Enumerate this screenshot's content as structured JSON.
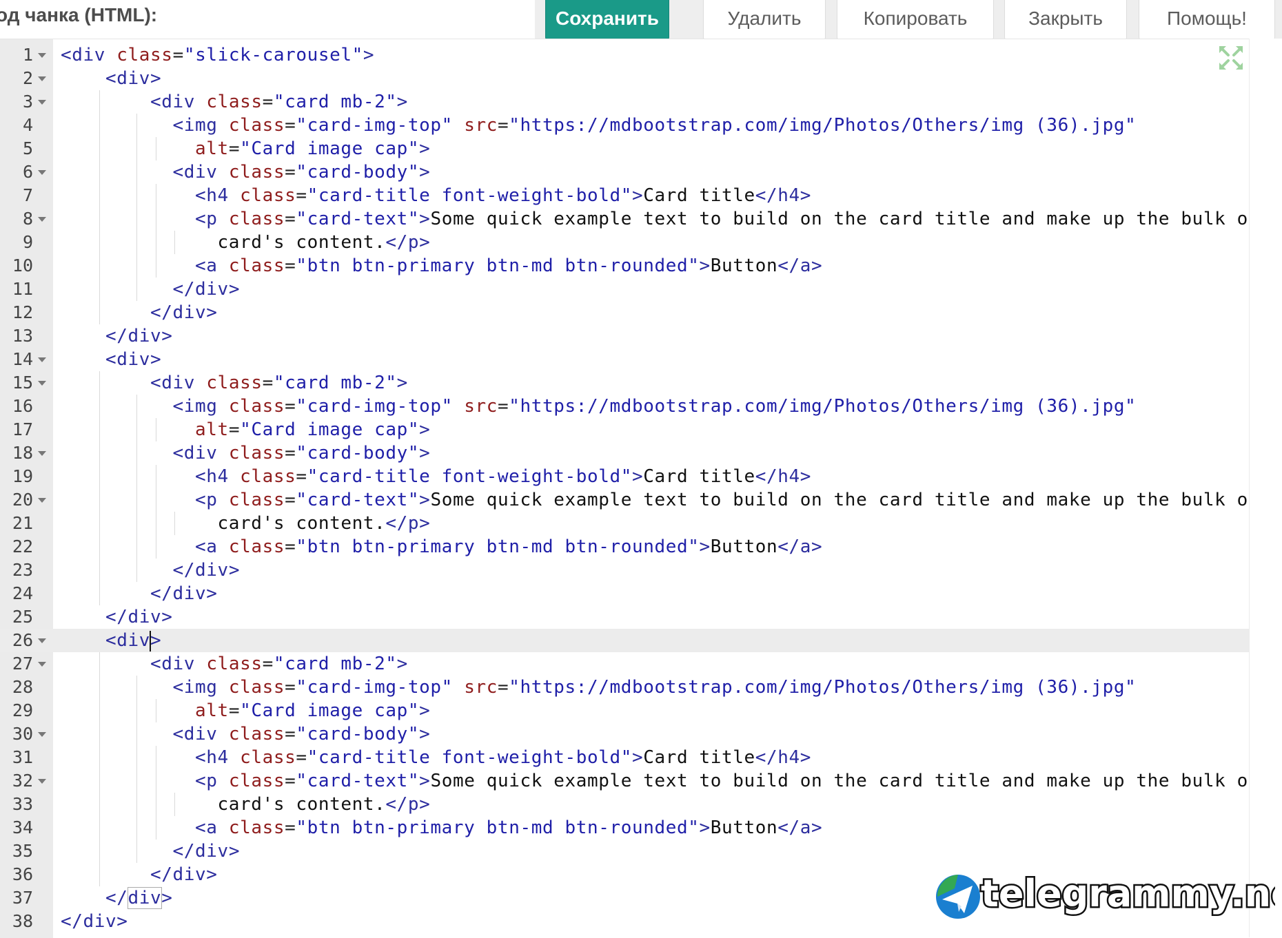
{
  "header": {
    "label": "од чанка (HTML):"
  },
  "toolbar": {
    "buttons": [
      {
        "label": "Сохранить",
        "primary": true
      },
      {
        "label": "Удалить"
      },
      {
        "label": "Копировать"
      },
      {
        "label": "Закрыть"
      },
      {
        "label": "Помощь!"
      }
    ]
  },
  "editor": {
    "active_line": 26,
    "fold_lines": [
      1,
      2,
      3,
      6,
      8,
      14,
      15,
      18,
      20,
      26,
      27,
      30,
      32
    ],
    "lines": [
      [
        [
          "tag",
          "<div"
        ],
        [
          "pun",
          " "
        ],
        [
          "attr",
          "class"
        ],
        [
          "pun",
          "="
        ],
        [
          "str",
          "\"slick-carousel\""
        ],
        [
          "tag",
          ">"
        ]
      ],
      [
        [
          "pun",
          "    "
        ],
        [
          "tag",
          "<div>"
        ]
      ],
      [
        [
          "pun",
          "        "
        ],
        [
          "tag",
          "<div"
        ],
        [
          "pun",
          " "
        ],
        [
          "attr",
          "class"
        ],
        [
          "pun",
          "="
        ],
        [
          "str",
          "\"card mb-2\""
        ],
        [
          "tag",
          ">"
        ]
      ],
      [
        [
          "pun",
          "          "
        ],
        [
          "tag",
          "<img"
        ],
        [
          "pun",
          " "
        ],
        [
          "attr",
          "class"
        ],
        [
          "pun",
          "="
        ],
        [
          "str",
          "\"card-img-top\""
        ],
        [
          "pun",
          " "
        ],
        [
          "attr",
          "src"
        ],
        [
          "pun",
          "="
        ],
        [
          "str",
          "\"https://mdbootstrap.com/img/Photos/Others/img (36).jpg\""
        ]
      ],
      [
        [
          "pun",
          "            "
        ],
        [
          "attr",
          "alt"
        ],
        [
          "pun",
          "="
        ],
        [
          "str",
          "\"Card image cap\""
        ],
        [
          "tag",
          ">"
        ]
      ],
      [
        [
          "pun",
          "          "
        ],
        [
          "tag",
          "<div"
        ],
        [
          "pun",
          " "
        ],
        [
          "attr",
          "class"
        ],
        [
          "pun",
          "="
        ],
        [
          "str",
          "\"card-body\""
        ],
        [
          "tag",
          ">"
        ]
      ],
      [
        [
          "pun",
          "            "
        ],
        [
          "tag",
          "<h4"
        ],
        [
          "pun",
          " "
        ],
        [
          "attr",
          "class"
        ],
        [
          "pun",
          "="
        ],
        [
          "str",
          "\"card-title font-weight-bold\""
        ],
        [
          "tag",
          ">"
        ],
        [
          "txt",
          "Card title"
        ],
        [
          "tag",
          "</h4>"
        ]
      ],
      [
        [
          "pun",
          "            "
        ],
        [
          "tag",
          "<p"
        ],
        [
          "pun",
          " "
        ],
        [
          "attr",
          "class"
        ],
        [
          "pun",
          "="
        ],
        [
          "str",
          "\"card-text\""
        ],
        [
          "tag",
          ">"
        ],
        [
          "txt",
          "Some quick example text to build on the card title and make up the bulk of"
        ]
      ],
      [
        [
          "pun",
          "              "
        ],
        [
          "txt",
          "card's content."
        ],
        [
          "tag",
          "</p>"
        ]
      ],
      [
        [
          "pun",
          "            "
        ],
        [
          "tag",
          "<a"
        ],
        [
          "pun",
          " "
        ],
        [
          "attr",
          "class"
        ],
        [
          "pun",
          "="
        ],
        [
          "str",
          "\"btn btn-primary btn-md btn-rounded\""
        ],
        [
          "tag",
          ">"
        ],
        [
          "txt",
          "Button"
        ],
        [
          "tag",
          "</a>"
        ]
      ],
      [
        [
          "pun",
          "          "
        ],
        [
          "tag",
          "</div>"
        ]
      ],
      [
        [
          "pun",
          "        "
        ],
        [
          "tag",
          "</div>"
        ]
      ],
      [
        [
          "pun",
          "    "
        ],
        [
          "tag",
          "</div>"
        ]
      ],
      [
        [
          "pun",
          "    "
        ],
        [
          "tag",
          "<div>"
        ]
      ],
      [
        [
          "pun",
          "        "
        ],
        [
          "tag",
          "<div"
        ],
        [
          "pun",
          " "
        ],
        [
          "attr",
          "class"
        ],
        [
          "pun",
          "="
        ],
        [
          "str",
          "\"card mb-2\""
        ],
        [
          "tag",
          ">"
        ]
      ],
      [
        [
          "pun",
          "          "
        ],
        [
          "tag",
          "<img"
        ],
        [
          "pun",
          " "
        ],
        [
          "attr",
          "class"
        ],
        [
          "pun",
          "="
        ],
        [
          "str",
          "\"card-img-top\""
        ],
        [
          "pun",
          " "
        ],
        [
          "attr",
          "src"
        ],
        [
          "pun",
          "="
        ],
        [
          "str",
          "\"https://mdbootstrap.com/img/Photos/Others/img (36).jpg\""
        ]
      ],
      [
        [
          "pun",
          "            "
        ],
        [
          "attr",
          "alt"
        ],
        [
          "pun",
          "="
        ],
        [
          "str",
          "\"Card image cap\""
        ],
        [
          "tag",
          ">"
        ]
      ],
      [
        [
          "pun",
          "          "
        ],
        [
          "tag",
          "<div"
        ],
        [
          "pun",
          " "
        ],
        [
          "attr",
          "class"
        ],
        [
          "pun",
          "="
        ],
        [
          "str",
          "\"card-body\""
        ],
        [
          "tag",
          ">"
        ]
      ],
      [
        [
          "pun",
          "            "
        ],
        [
          "tag",
          "<h4"
        ],
        [
          "pun",
          " "
        ],
        [
          "attr",
          "class"
        ],
        [
          "pun",
          "="
        ],
        [
          "str",
          "\"card-title font-weight-bold\""
        ],
        [
          "tag",
          ">"
        ],
        [
          "txt",
          "Card title"
        ],
        [
          "tag",
          "</h4>"
        ]
      ],
      [
        [
          "pun",
          "            "
        ],
        [
          "tag",
          "<p"
        ],
        [
          "pun",
          " "
        ],
        [
          "attr",
          "class"
        ],
        [
          "pun",
          "="
        ],
        [
          "str",
          "\"card-text\""
        ],
        [
          "tag",
          ">"
        ],
        [
          "txt",
          "Some quick example text to build on the card title and make up the bulk of"
        ]
      ],
      [
        [
          "pun",
          "              "
        ],
        [
          "txt",
          "card's content."
        ],
        [
          "tag",
          "</p>"
        ]
      ],
      [
        [
          "pun",
          "            "
        ],
        [
          "tag",
          "<a"
        ],
        [
          "pun",
          " "
        ],
        [
          "attr",
          "class"
        ],
        [
          "pun",
          "="
        ],
        [
          "str",
          "\"btn btn-primary btn-md btn-rounded\""
        ],
        [
          "tag",
          ">"
        ],
        [
          "txt",
          "Button"
        ],
        [
          "tag",
          "</a>"
        ]
      ],
      [
        [
          "pun",
          "          "
        ],
        [
          "tag",
          "</div>"
        ]
      ],
      [
        [
          "pun",
          "        "
        ],
        [
          "tag",
          "</div>"
        ]
      ],
      [
        [
          "pun",
          "    "
        ],
        [
          "tag",
          "</div>"
        ]
      ],
      [
        [
          "pun",
          "    "
        ],
        [
          "tag",
          "<div"
        ],
        [
          "cursor",
          ""
        ],
        [
          "tag",
          ">"
        ]
      ],
      [
        [
          "pun",
          "        "
        ],
        [
          "tag",
          "<div"
        ],
        [
          "pun",
          " "
        ],
        [
          "attr",
          "class"
        ],
        [
          "pun",
          "="
        ],
        [
          "str",
          "\"card mb-2\""
        ],
        [
          "tag",
          ">"
        ]
      ],
      [
        [
          "pun",
          "          "
        ],
        [
          "tag",
          "<img"
        ],
        [
          "pun",
          " "
        ],
        [
          "attr",
          "class"
        ],
        [
          "pun",
          "="
        ],
        [
          "str",
          "\"card-img-top\""
        ],
        [
          "pun",
          " "
        ],
        [
          "attr",
          "src"
        ],
        [
          "pun",
          "="
        ],
        [
          "str",
          "\"https://mdbootstrap.com/img/Photos/Others/img (36).jpg\""
        ]
      ],
      [
        [
          "pun",
          "            "
        ],
        [
          "attr",
          "alt"
        ],
        [
          "pun",
          "="
        ],
        [
          "str",
          "\"Card image cap\""
        ],
        [
          "tag",
          ">"
        ]
      ],
      [
        [
          "pun",
          "          "
        ],
        [
          "tag",
          "<div"
        ],
        [
          "pun",
          " "
        ],
        [
          "attr",
          "class"
        ],
        [
          "pun",
          "="
        ],
        [
          "str",
          "\"card-body\""
        ],
        [
          "tag",
          ">"
        ]
      ],
      [
        [
          "pun",
          "            "
        ],
        [
          "tag",
          "<h4"
        ],
        [
          "pun",
          " "
        ],
        [
          "attr",
          "class"
        ],
        [
          "pun",
          "="
        ],
        [
          "str",
          "\"card-title font-weight-bold\""
        ],
        [
          "tag",
          ">"
        ],
        [
          "txt",
          "Card title"
        ],
        [
          "tag",
          "</h4>"
        ]
      ],
      [
        [
          "pun",
          "            "
        ],
        [
          "tag",
          "<p"
        ],
        [
          "pun",
          " "
        ],
        [
          "attr",
          "class"
        ],
        [
          "pun",
          "="
        ],
        [
          "str",
          "\"card-text\""
        ],
        [
          "tag",
          ">"
        ],
        [
          "txt",
          "Some quick example text to build on the card title and make up the bulk of"
        ]
      ],
      [
        [
          "pun",
          "              "
        ],
        [
          "txt",
          "card's content."
        ],
        [
          "tag",
          "</p>"
        ]
      ],
      [
        [
          "pun",
          "            "
        ],
        [
          "tag",
          "<a"
        ],
        [
          "pun",
          " "
        ],
        [
          "attr",
          "class"
        ],
        [
          "pun",
          "="
        ],
        [
          "str",
          "\"btn btn-primary btn-md btn-rounded\""
        ],
        [
          "tag",
          ">"
        ],
        [
          "txt",
          "Button"
        ],
        [
          "tag",
          "</a>"
        ]
      ],
      [
        [
          "pun",
          "          "
        ],
        [
          "tag",
          "</div>"
        ]
      ],
      [
        [
          "pun",
          "        "
        ],
        [
          "tag",
          "</div>"
        ]
      ],
      [
        [
          "pun",
          "    "
        ],
        [
          "tag",
          "</"
        ],
        [
          "match",
          "div"
        ],
        [
          "tag",
          ">"
        ]
      ],
      [
        [
          "tag",
          "</div>"
        ]
      ]
    ]
  },
  "watermark": {
    "text": "telegrammy.net"
  },
  "colors": {
    "primary_button": "#1a9a88",
    "tag": "#2c2d9e",
    "attribute": "#8f1d1d",
    "string": "#1f1fa8",
    "gutter": "#ebebeb"
  },
  "icons": {
    "expand": "expand-arrows-icon",
    "watermark": "telegram-globe-icon"
  }
}
